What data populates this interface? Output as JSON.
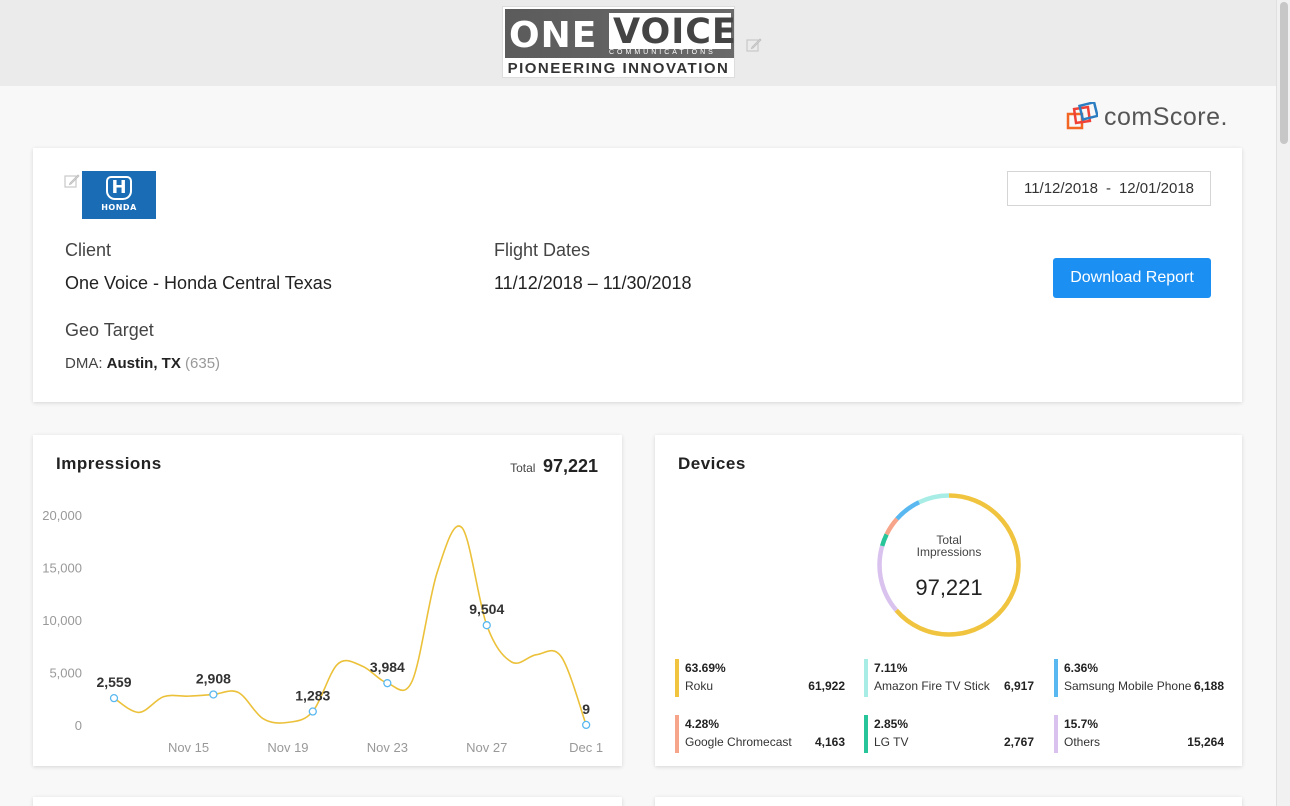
{
  "header": {
    "logo_one": "ONE",
    "logo_voice": "VOICE",
    "logo_communications": "COMMUNICATIONS",
    "logo_tagline": "PIONEERING INNOVATION",
    "partner_logo": "comScore."
  },
  "campaign": {
    "client_label": "Client",
    "client_value": "One Voice - Honda Central Texas",
    "flight_label": "Flight Dates",
    "flight_value": "11/12/2018 – 11/30/2018",
    "geo_label": "Geo Target",
    "dma_prefix": "DMA:",
    "dma_value": "Austin, TX",
    "dma_code": "(635)",
    "brand_logo": "HONDA",
    "date_start": "11/12/2018",
    "date_sep": "-",
    "date_end": "12/01/2018",
    "download_label": "Download Report"
  },
  "impressions": {
    "title": "Impressions",
    "total_label": "Total",
    "total_value": "97,221"
  },
  "devices": {
    "title": "Devices",
    "center_label_1": "Total",
    "center_label_2": "Impressions",
    "center_value": "97,221",
    "items": [
      {
        "pct": "63.69%",
        "name": "Roku",
        "count": "61,922",
        "color": "#f0c43e"
      },
      {
        "pct": "7.11%",
        "name": "Amazon Fire TV Stick",
        "count": "6,917",
        "color": "#a8ece6"
      },
      {
        "pct": "6.36%",
        "name": "Samsung Mobile Phone",
        "count": "6,188",
        "color": "#5ab8f0"
      },
      {
        "pct": "4.28%",
        "name": "Google Chromecast",
        "count": "4,163",
        "color": "#f7a58a"
      },
      {
        "pct": "2.85%",
        "name": "LG TV",
        "count": "2,767",
        "color": "#28c49a"
      },
      {
        "pct": "15.7%",
        "name": "Others",
        "count": "15,264",
        "color": "#d9c2ee"
      }
    ]
  },
  "chart_data": {
    "type": "line",
    "title": "Impressions",
    "xlabel": "",
    "ylabel": "",
    "ylim": [
      0,
      20000
    ],
    "y_ticks": [
      "20,000",
      "15,000",
      "10,000",
      "5,000",
      "0"
    ],
    "x_ticks": [
      "Nov 15",
      "Nov 19",
      "Nov 23",
      "Nov 27",
      "Dec 1"
    ],
    "x": [
      "Nov 12",
      "Nov 13",
      "Nov 14",
      "Nov 15",
      "Nov 16",
      "Nov 17",
      "Nov 18",
      "Nov 19",
      "Nov 20",
      "Nov 21",
      "Nov 22",
      "Nov 23",
      "Nov 24",
      "Nov 25",
      "Nov 26",
      "Nov 27",
      "Nov 28",
      "Nov 29",
      "Nov 30",
      "Dec 1"
    ],
    "values": [
      2559,
      1200,
      2700,
      2750,
      2908,
      3100,
      600,
      250,
      1283,
      5800,
      5600,
      3984,
      4200,
      14500,
      18800,
      9504,
      6000,
      6700,
      6500,
      9
    ],
    "labeled_points": [
      {
        "x": "Nov 12",
        "value": 2559,
        "label": "2,559"
      },
      {
        "x": "Nov 16",
        "value": 2908,
        "label": "2,908"
      },
      {
        "x": "Nov 20",
        "value": 1283,
        "label": "1,283"
      },
      {
        "x": "Nov 23",
        "value": 3984,
        "label": "3,984"
      },
      {
        "x": "Nov 27",
        "value": 9504,
        "label": "9,504"
      },
      {
        "x": "Dec 1",
        "value": 9,
        "label": "9"
      }
    ],
    "line_color": "#ecc13a",
    "marker_color": "#5ab8f0",
    "grid": false
  }
}
